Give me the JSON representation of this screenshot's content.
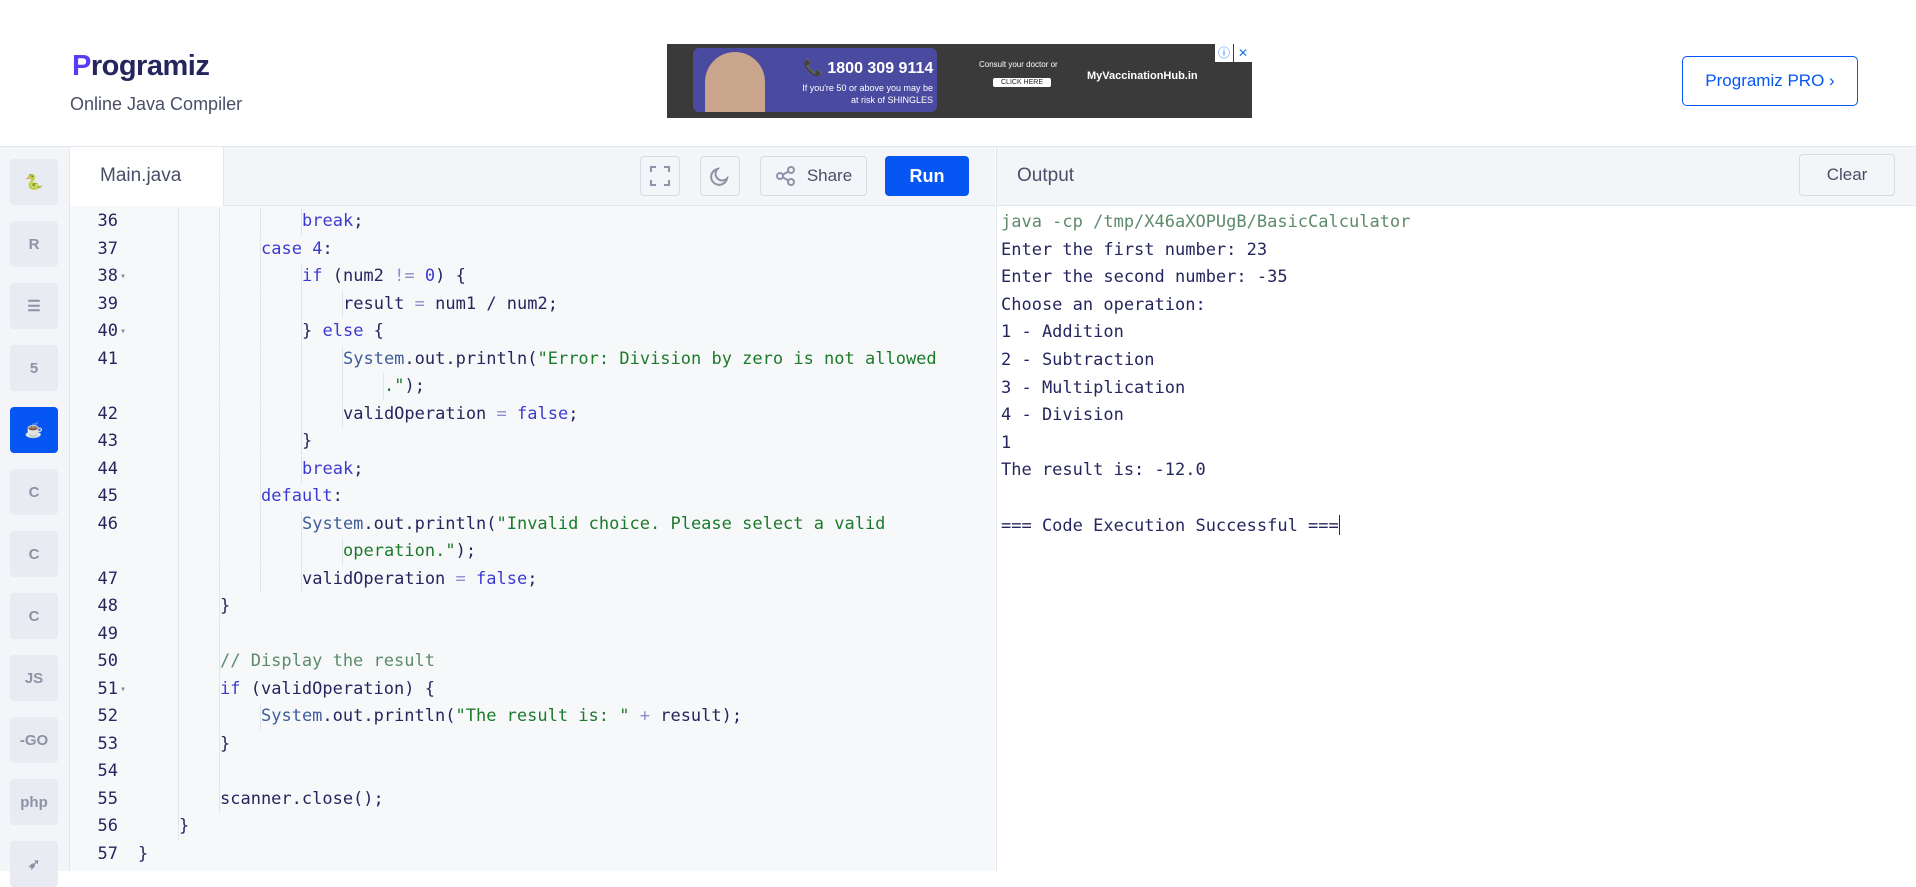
{
  "header": {
    "logo_text": "rogramiz",
    "logo_initial": "P",
    "subtitle": "Online Java Compiler",
    "pro_button": "Programiz PRO ›"
  },
  "ad": {
    "phone": "📞 1800 309 9114",
    "tagline_1": "If you're 50 or above you may be",
    "tagline_2": "at risk of SHINGLES",
    "consult": "Consult your doctor or",
    "click": "CLICK HERE",
    "hub": "MyVaccinationHub.in",
    "info_icon": "ⓘ",
    "close_icon": "✕"
  },
  "sidebar": {
    "items": [
      {
        "name": "python",
        "glyph": "🐍"
      },
      {
        "name": "r",
        "glyph": "R"
      },
      {
        "name": "sql",
        "glyph": "☰"
      },
      {
        "name": "html",
        "glyph": "5"
      },
      {
        "name": "java",
        "glyph": "☕"
      },
      {
        "name": "c",
        "glyph": "C"
      },
      {
        "name": "cpp",
        "glyph": "C"
      },
      {
        "name": "csharp",
        "glyph": "C"
      },
      {
        "name": "js",
        "glyph": "JS"
      },
      {
        "name": "go",
        "glyph": "-GO"
      },
      {
        "name": "php",
        "glyph": "php"
      },
      {
        "name": "swift",
        "glyph": "➶"
      }
    ],
    "active": "java"
  },
  "editor": {
    "file_name": "Main.java",
    "share_label": "Share",
    "run_label": "Run",
    "lines": [
      {
        "n": "36",
        "fold": "",
        "indent": 4,
        "html": "<span class=\"kw\">break</span>;"
      },
      {
        "n": "37",
        "fold": "",
        "indent": 3,
        "html": "<span class=\"kw\">case</span> <span class=\"num\">4</span>:"
      },
      {
        "n": "38",
        "fold": "▾",
        "indent": 4,
        "html": "<span class=\"kw\">if</span> (num2 <span class=\"op\">!=</span> <span class=\"num\">0</span>) {"
      },
      {
        "n": "39",
        "fold": "",
        "indent": 5,
        "html": "result <span class=\"op\">=</span> num1 / num2;"
      },
      {
        "n": "40",
        "fold": "▾",
        "indent": 4,
        "html": "} <span class=\"kw\">else</span> {"
      },
      {
        "n": "41",
        "fold": "",
        "indent": 5,
        "html": "<span class=\"cls\">System</span>.out.println(<span class=\"str\">\"Error: Division by zero is not allowed</span>"
      },
      {
        "n": "",
        "fold": "",
        "indent": 6,
        "html": "<span class=\"str\">.\"</span>);"
      },
      {
        "n": "42",
        "fold": "",
        "indent": 5,
        "html": "validOperation <span class=\"op\">=</span> <span class=\"kw\">false</span>;"
      },
      {
        "n": "43",
        "fold": "",
        "indent": 4,
        "html": "}"
      },
      {
        "n": "44",
        "fold": "",
        "indent": 4,
        "html": "<span class=\"kw\">break</span>;"
      },
      {
        "n": "45",
        "fold": "",
        "indent": 3,
        "html": "<span class=\"kw\">default</span>:"
      },
      {
        "n": "46",
        "fold": "",
        "indent": 4,
        "html": "<span class=\"cls\">System</span>.out.println(<span class=\"str\">\"Invalid choice. Please select a valid</span>"
      },
      {
        "n": "",
        "fold": "",
        "indent": 5,
        "html": "<span class=\"str\">operation.\"</span>);"
      },
      {
        "n": "47",
        "fold": "",
        "indent": 4,
        "html": "validOperation <span class=\"op\">=</span> <span class=\"kw\">false</span>;"
      },
      {
        "n": "48",
        "fold": "",
        "indent": 2,
        "html": "}"
      },
      {
        "n": "49",
        "fold": "",
        "indent": 2,
        "html": ""
      },
      {
        "n": "50",
        "fold": "",
        "indent": 2,
        "html": "<span class=\"cmt\">// Display the result</span>"
      },
      {
        "n": "51",
        "fold": "▾",
        "indent": 2,
        "html": "<span class=\"kw\">if</span> (validOperation) {"
      },
      {
        "n": "52",
        "fold": "",
        "indent": 3,
        "html": "<span class=\"cls\">System</span>.out.println(<span class=\"str\">\"The result is: \"</span> <span class=\"op\">+</span> result);"
      },
      {
        "n": "53",
        "fold": "",
        "indent": 2,
        "html": "}"
      },
      {
        "n": "54",
        "fold": "",
        "indent": 2,
        "html": ""
      },
      {
        "n": "55",
        "fold": "",
        "indent": 2,
        "html": "scanner.close();"
      },
      {
        "n": "56",
        "fold": "",
        "indent": 1,
        "html": "}"
      },
      {
        "n": "57",
        "fold": "",
        "indent": 0,
        "html": "}"
      }
    ]
  },
  "output": {
    "title": "Output",
    "clear_label": "Clear",
    "lines": [
      {
        "text": "java -cp /tmp/X46aXOPUgB/BasicCalculator",
        "cmd": true
      },
      {
        "text": "Enter the first number: 23"
      },
      {
        "text": "Enter the second number: -35"
      },
      {
        "text": "Choose an operation:"
      },
      {
        "text": "1 - Addition"
      },
      {
        "text": "2 - Subtraction"
      },
      {
        "text": "3 - Multiplication"
      },
      {
        "text": "4 - Division"
      },
      {
        "text": "1"
      },
      {
        "text": "The result is: -12.0"
      },
      {
        "text": ""
      },
      {
        "text": "=== Code Execution Successful ===",
        "caret": true
      }
    ]
  }
}
